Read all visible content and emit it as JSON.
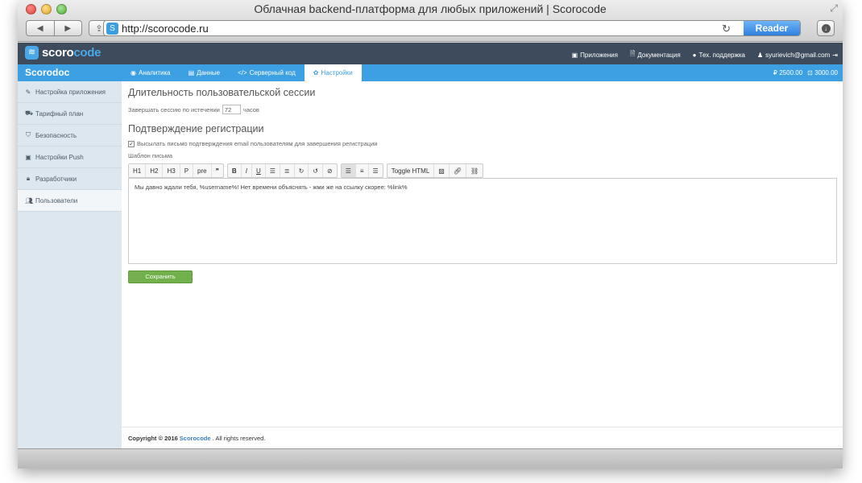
{
  "browser": {
    "window_title": "Облачная backend-платформа для любых приложений | Scorocode",
    "url": "http://scorocode.ru",
    "reader_label": "Reader"
  },
  "header": {
    "logo_text_left": "scoro",
    "logo_text_right": "code",
    "nav": {
      "apps": "Приложения",
      "docs": "Документация",
      "support": "Тех. поддержка",
      "user_email": "syurievich@gmail.com"
    }
  },
  "appbar": {
    "app_name": "Scorodoc",
    "tabs": [
      {
        "label": "Аналитика"
      },
      {
        "label": "Данные"
      },
      {
        "label": "Серверный код"
      },
      {
        "label": "Настройки"
      }
    ],
    "balance": {
      "amount": "2500.00",
      "secondary": "3000.00"
    }
  },
  "sidebar": {
    "items": [
      {
        "label": "Настройка приложения"
      },
      {
        "label": "Тарифный план"
      },
      {
        "label": "Безопасность"
      },
      {
        "label": "Настройки Push"
      },
      {
        "label": "Разработчики"
      },
      {
        "label": "Пользователи"
      }
    ]
  },
  "main": {
    "session_title": "Длительность пользовательской сессии",
    "session_prefix": "Завершать сессию по истечении",
    "session_value": "72",
    "session_suffix": "часов",
    "registration_title": "Подтверждение регистрации",
    "send_email_label": "Высылать письмо подтверждения email пользователям для завершения регистрации",
    "template_label": "Шаблон письма",
    "toolbar": {
      "h1": "H1",
      "h2": "H2",
      "h3": "H3",
      "p": "P",
      "pre": "pre",
      "quote": "❞",
      "bold": "B",
      "italic": "I",
      "underline": "U",
      "toggle_html": "Toggle HTML"
    },
    "editor_text": "Мы давно ждали тебя, %username%! Нет времени объяснять - жми же на ссылку скорее: %link%",
    "save_label": "Сохранить"
  },
  "footer": {
    "prefix": "Copyright © 2016",
    "brand": "Scorocode",
    "suffix": ". All rights reserved."
  },
  "colors": {
    "header_bg": "#3d4b5c",
    "accent_blue": "#3da0e3",
    "sidebar_bg": "#dde7ef",
    "save_green": "#71b04a"
  }
}
